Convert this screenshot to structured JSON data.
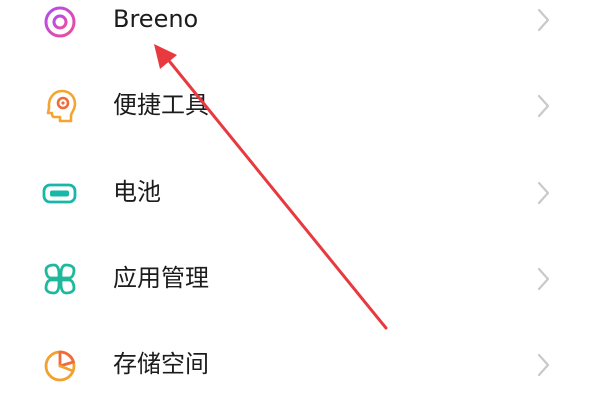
{
  "settings": {
    "items": [
      {
        "label": "Breeno",
        "icon": "breeno-ring-icon",
        "color": "#d44fe0"
      },
      {
        "label": "便捷工具",
        "icon": "head-gear-icon",
        "color": "#f29f32"
      },
      {
        "label": "电池",
        "icon": "battery-icon",
        "color": "#18b8a8"
      },
      {
        "label": "应用管理",
        "icon": "app-grid-icon",
        "color": "#1fb89d"
      },
      {
        "label": "存储空间",
        "icon": "storage-pie-icon",
        "color": "#f2a12e"
      }
    ]
  },
  "annotation": {
    "arrow_color": "#e8393f",
    "target": "Breeno"
  }
}
